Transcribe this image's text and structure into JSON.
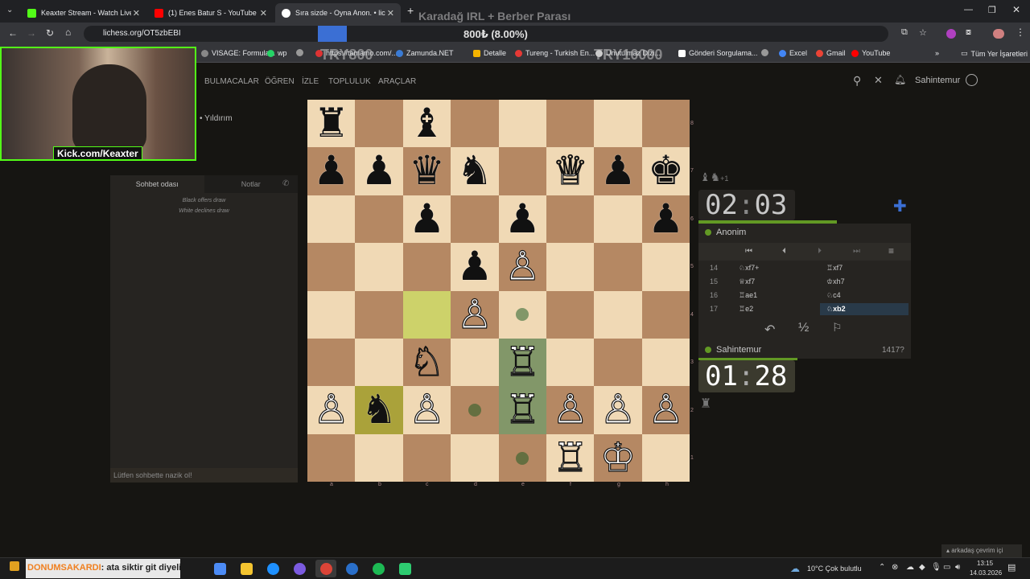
{
  "browser": {
    "tabs": [
      {
        "title": "Keaxter Stream - Watch Live on",
        "color": "#53fc18",
        "active": false
      },
      {
        "title": "(1) Enes Batur S - YouTube",
        "color": "#ff0000",
        "active": false
      },
      {
        "title": "Sıra sizde - Oyna Anon. • liche",
        "color": "#ffffff",
        "active": true
      }
    ],
    "url": "lichess.org/OT5zbEBI",
    "bookmarks": [
      {
        "label": "VISAGE: Formula...",
        "color": "#888"
      },
      {
        "label": "wp",
        "color": "#25d366"
      },
      {
        "label": "",
        "color": "#999"
      },
      {
        "label": "https://tamamo.com/...",
        "color": "#d33"
      },
      {
        "label": "Zamunda.NET",
        "color": "#3a7bd5"
      },
      {
        "label": "Detalle",
        "color": "#f4b400"
      },
      {
        "label": "Tureng - Turkish En...",
        "color": "#e53935"
      },
      {
        "label": "Unutulmaz Dizi...",
        "color": "#ccc"
      },
      {
        "label": "Gönderi Sorgulama...",
        "color": "#fff"
      },
      {
        "label": "",
        "color": "#999"
      },
      {
        "label": "Excel",
        "color": "#4285f4"
      },
      {
        "label": "Gmail",
        "color": "#ea4335"
      },
      {
        "label": "YouTube",
        "color": "#ff0000"
      }
    ],
    "all_bookmarks": "Tüm Yer İşaretleri"
  },
  "overlay": {
    "stream_title": "Karadağ IRL + Berber Parası",
    "progress_text": "800₺ (8.00%)",
    "goal_left": "TRY800",
    "goal_right": "TRY10000",
    "webcam_label": "Kick.com/Keaxter"
  },
  "nav": {
    "links": [
      "BULMACALAR",
      "ÖĞREN",
      "İZLE",
      "TOPLULUK",
      "ARAÇLAR"
    ],
    "username": "Sahintemur"
  },
  "game": {
    "type": "• Yıldırım",
    "chat_tabs": [
      "Sohbet odası",
      "Notlar"
    ],
    "messages": [
      "Black offers draw",
      "White declines draw"
    ],
    "chat_placeholder": "Lütfen sohbette nazik ol!"
  },
  "players": {
    "top": {
      "name": "Anonim",
      "clock_min": "02",
      "clock_sec": "03",
      "captured": "+1"
    },
    "bottom": {
      "name": "Sahintemur",
      "rating": "1417?",
      "clock_min": "01",
      "clock_sec": "28"
    }
  },
  "moves": [
    {
      "no": "14",
      "white": "♘xf7+",
      "black": "♖xf7"
    },
    {
      "no": "15",
      "white": "♕xf7",
      "black": "♔xh7"
    },
    {
      "no": "16",
      "white": "♖ae1",
      "black": "♘c4"
    },
    {
      "no": "17",
      "white": "♖e2",
      "black": "♘xb2"
    }
  ],
  "move_actions": {
    "draw": "½"
  },
  "board": {
    "files": [
      "a",
      "b",
      "c",
      "d",
      "e",
      "f",
      "g",
      "h"
    ],
    "ranks": [
      "8",
      "7",
      "6",
      "5",
      "4",
      "3",
      "2",
      "1"
    ]
  },
  "taskbar": {
    "stream_ticker_name": "DONUMSAKARDI",
    "stream_ticker_msg": ": ata siktir git diyelim",
    "weather": "10°C  Çok bulutlu",
    "time": "13:15",
    "date": "14.03.2026",
    "friends_online": "arkadaş çevrim içi"
  }
}
